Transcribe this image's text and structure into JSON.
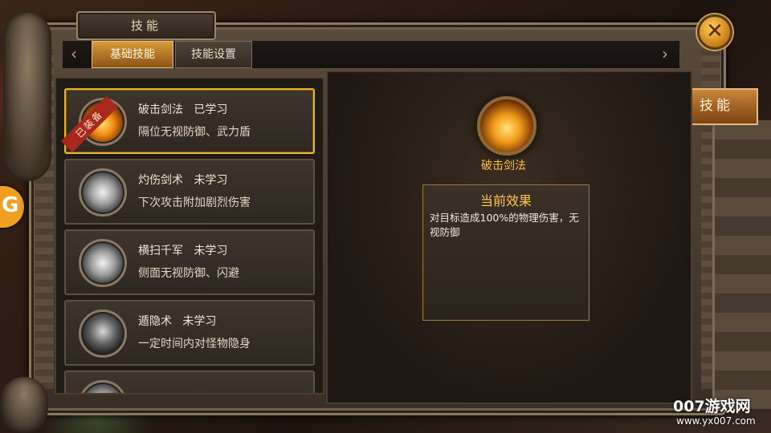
{
  "window": {
    "title": "技能"
  },
  "tabs": [
    {
      "label": "基础技能",
      "active": true
    },
    {
      "label": "技能设置",
      "active": false
    }
  ],
  "side_tab": {
    "label": "技能"
  },
  "skills": [
    {
      "name": "破击剑法",
      "status": "已学习",
      "desc": "隔位无视防御、武力盾",
      "icon": "fire-slash-icon",
      "equipped_badge": "已装备",
      "selected": true
    },
    {
      "name": "灼伤剑术",
      "status": "未学习",
      "desc": "下次攻击附加剧烈伤害",
      "icon": "wind-slash-icon"
    },
    {
      "name": "横扫千军",
      "status": "未学习",
      "desc": "侧面无视防御、闪避",
      "icon": "sweep-icon"
    },
    {
      "name": "遁隐术",
      "status": "未学习",
      "desc": "一定时间内对怪物隐身",
      "icon": "stealth-icon"
    }
  ],
  "detail": {
    "name": "破击剑法",
    "effect_title": "当前效果",
    "effect_text": "对目标造成100%的物理伤害，无视防御"
  },
  "watermark": {
    "brand": "007游戏网",
    "url": "www.yx007.com"
  },
  "colors": {
    "accent": "#e8b42a",
    "gold_text": "#ffc040",
    "ribbon": "#a8281e"
  }
}
